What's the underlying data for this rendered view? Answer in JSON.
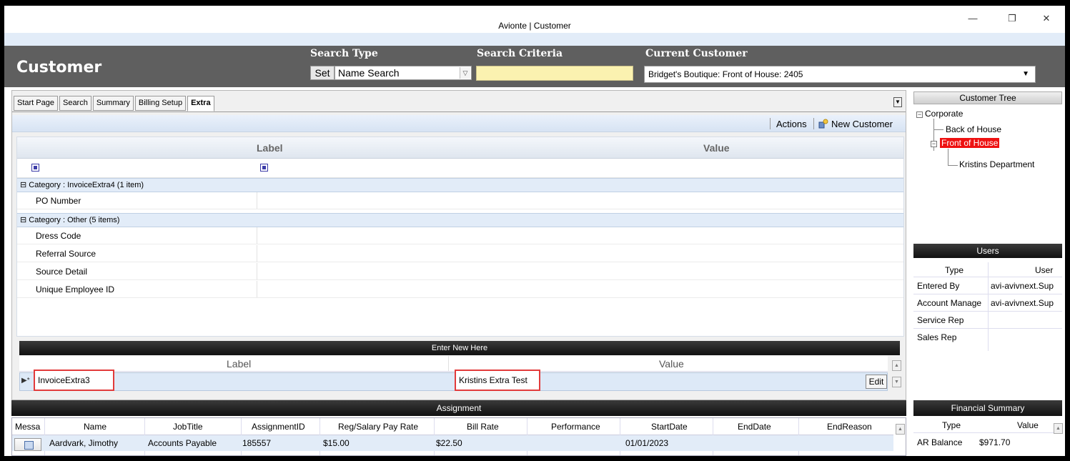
{
  "window": {
    "title": "Avionte | Customer",
    "minimize": "—",
    "restore": "❐",
    "close": "✕"
  },
  "header": {
    "app_title": "Customer",
    "search_type_label": "Search Type",
    "set_button": "Set",
    "search_type_value": "Name Search",
    "search_criteria_label": "Search Criteria",
    "search_criteria_value": "",
    "current_customer_label": "Current Customer",
    "current_customer_value": "Bridget's Boutique: Front of House: 2405"
  },
  "tabs": [
    "Start Page",
    "Search",
    "Summary",
    "Billing Setup",
    "Extra"
  ],
  "active_tab": "Extra",
  "toolbar": {
    "actions": "Actions",
    "new_customer": "New Customer"
  },
  "extra_grid": {
    "col_label": "Label",
    "col_value": "Value",
    "categories": [
      {
        "title": "Category : InvoiceExtra4 (1 item)",
        "rows": [
          "PO Number"
        ]
      },
      {
        "title": "Category : Other (5 items)",
        "rows": [
          "Dress Code",
          "Referral Source",
          "Source Detail",
          "Unique Employee ID"
        ]
      }
    ]
  },
  "enter_new": {
    "header": "Enter New Here",
    "col_label": "Label",
    "col_value": "Value",
    "label_value": "InvoiceExtra3",
    "value_value": "Kristins Extra Test",
    "edit_button": "Edit"
  },
  "assignment": {
    "header": "Assignment",
    "columns": [
      "Messa",
      "Name",
      "JobTitle",
      "AssignmentID",
      "Reg/Salary Pay Rate",
      "Bill Rate",
      "Performance",
      "StartDate",
      "EndDate",
      "EndReason"
    ],
    "rows": [
      {
        "name": "Aardvark, Jimothy",
        "job_title": "Accounts Payable",
        "assignment_id": "185557",
        "pay_rate": "$15.00",
        "bill_rate": "$22.50",
        "performance": "",
        "start_date": "01/01/2023",
        "end_date": "",
        "end_reason": ""
      }
    ]
  },
  "customer_tree": {
    "header": "Customer Tree",
    "root": "Corporate",
    "child1": "Back of House",
    "child2": "Front of House",
    "grandchild": "Kristins Department"
  },
  "users": {
    "header": "Users",
    "col_type": "Type",
    "col_user": "User",
    "rows": [
      {
        "type": "Entered By",
        "user": "avi-avivnext.Sup"
      },
      {
        "type": "Account Manage",
        "user": "avi-avivnext.Sup"
      },
      {
        "type": "Service Rep",
        "user": ""
      },
      {
        "type": "Sales Rep",
        "user": ""
      }
    ]
  },
  "financial_summary": {
    "header": "Financial Summary",
    "col_type": "Type",
    "col_value": "Value",
    "rows": [
      {
        "type": "AR Balance",
        "value": "$971.70"
      }
    ]
  },
  "colors": {
    "selected_node": "#ee1111",
    "highlight_box": "#e23b3b",
    "criteria_bg": "#fbf2b0",
    "header_band": "#5f5f5f"
  }
}
